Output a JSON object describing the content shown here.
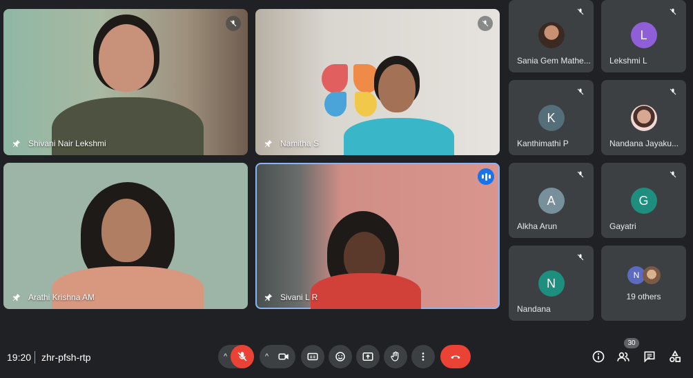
{
  "participants_main": [
    {
      "name": "Shivani Nair Lekshmi",
      "muted": true
    },
    {
      "name": "Namitha S",
      "muted": true
    },
    {
      "name": "Arathi Krishna AM",
      "muted": false
    },
    {
      "name": "Sivani L R",
      "muted": false,
      "speaking": true
    }
  ],
  "participants_side": [
    {
      "name": "Sania Gem Mathe...",
      "initial": "",
      "avatar_color": "#6d4c41",
      "has_photo": true
    },
    {
      "name": "Lekshmi L",
      "initial": "L",
      "avatar_color": "#8e5fd6"
    },
    {
      "name": "Kanthimathi P",
      "initial": "K",
      "avatar_color": "#546e7a"
    },
    {
      "name": "Nandana Jayaku...",
      "initial": "",
      "avatar_color": "#e7c7c0",
      "has_photo": true
    },
    {
      "name": "Alkha Arun",
      "initial": "A",
      "avatar_color": "#78909c"
    },
    {
      "name": "Gayatri",
      "initial": "G",
      "avatar_color": "#1e8e7e"
    },
    {
      "name": "Nandana",
      "initial": "N",
      "avatar_color": "#1e8e7e"
    }
  ],
  "others": {
    "label": "19 others",
    "initial": "N"
  },
  "bottom": {
    "time": "19:20",
    "meeting_code": "zhr-pfsh-rtp",
    "people_count": "30"
  },
  "colors": {
    "end_call": "#ea4335",
    "mic_off": "#ea4335",
    "speaking": "#1a73e8"
  }
}
